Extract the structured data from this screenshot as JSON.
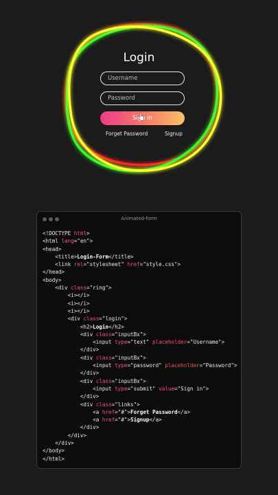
{
  "preview": {
    "title": "Login",
    "username_placeholder": "Username",
    "password_placeholder": "Password",
    "signin_label": "Sign in",
    "forget_label": "Forget Password",
    "signup_label": "Signup",
    "colors": {
      "ring_red": "#ff2424",
      "ring_green": "#2cff2c",
      "ring_yellow": "#ffff2c",
      "button_start": "#f03c8c",
      "button_end": "#fbc168"
    }
  },
  "editor": {
    "title": "Animated-form",
    "lines": [
      [
        {
          "t": "<!DOCTYPE "
        },
        {
          "t": "html",
          "c": "attr"
        },
        {
          "t": ">"
        }
      ],
      [
        {
          "t": "<html "
        },
        {
          "t": "lang",
          "c": "attr"
        },
        {
          "t": "=\"en\">"
        }
      ],
      [
        {
          "t": "<head>"
        }
      ],
      [
        {
          "t": "    <title>"
        },
        {
          "t": "Login-Form",
          "c": "bold"
        },
        {
          "t": "</title>"
        }
      ],
      [
        {
          "t": "    <link "
        },
        {
          "t": "rel",
          "c": "attr"
        },
        {
          "t": "=\"stylesheet\" "
        },
        {
          "t": "href",
          "c": "attr"
        },
        {
          "t": "=\"style.css\">"
        }
      ],
      [
        {
          "t": "</head>"
        }
      ],
      [
        {
          "t": "<body>"
        }
      ],
      [
        {
          "t": "    <div "
        },
        {
          "t": "class",
          "c": "attr"
        },
        {
          "t": "=\"ring\">"
        }
      ],
      [
        {
          "t": "        <i></i>"
        }
      ],
      [
        {
          "t": "        <i></i>"
        }
      ],
      [
        {
          "t": "        <i></i>"
        }
      ],
      [
        {
          "t": "        <div "
        },
        {
          "t": "class",
          "c": "attr"
        },
        {
          "t": "=\"login\">"
        }
      ],
      [
        {
          "t": "            <h2>"
        },
        {
          "t": "Login",
          "c": "bold"
        },
        {
          "t": "</h2>"
        }
      ],
      [
        {
          "t": "            <div "
        },
        {
          "t": "class",
          "c": "attr"
        },
        {
          "t": "=\"inputBx\">"
        }
      ],
      [
        {
          "t": "                <input "
        },
        {
          "t": "type",
          "c": "attr"
        },
        {
          "t": "=\"text\" "
        },
        {
          "t": "placeholder",
          "c": "attr"
        },
        {
          "t": "=\"Username\">"
        }
      ],
      [
        {
          "t": "            </div>"
        }
      ],
      [
        {
          "t": "            <div "
        },
        {
          "t": "class",
          "c": "attr"
        },
        {
          "t": "=\"inputBx\">"
        }
      ],
      [
        {
          "t": "                <input "
        },
        {
          "t": "type",
          "c": "attr"
        },
        {
          "t": "=\"password\" "
        },
        {
          "t": "placeholder",
          "c": "attr"
        },
        {
          "t": "=\"Password\">"
        }
      ],
      [
        {
          "t": "            </div>"
        }
      ],
      [
        {
          "t": "            <div "
        },
        {
          "t": "class",
          "c": "attr"
        },
        {
          "t": "=\"inputBx\">"
        }
      ],
      [
        {
          "t": "                <input "
        },
        {
          "t": "type",
          "c": "attr"
        },
        {
          "t": "=\"submit\" "
        },
        {
          "t": "value",
          "c": "attr"
        },
        {
          "t": "=\"Sign in\">"
        }
      ],
      [
        {
          "t": "            </div>"
        }
      ],
      [
        {
          "t": "            <div "
        },
        {
          "t": "class",
          "c": "attr"
        },
        {
          "t": "=\"links\">"
        }
      ],
      [
        {
          "t": "                <a "
        },
        {
          "t": "href",
          "c": "attr"
        },
        {
          "t": "=\"#\">"
        },
        {
          "t": "Forget Password",
          "c": "bold"
        },
        {
          "t": "</a>"
        }
      ],
      [
        {
          "t": "                <a "
        },
        {
          "t": "href",
          "c": "attr"
        },
        {
          "t": "=\"#\">"
        },
        {
          "t": "Signup",
          "c": "bold"
        },
        {
          "t": "</a>"
        }
      ],
      [
        {
          "t": "            </div>"
        }
      ],
      [
        {
          "t": "        </div>"
        }
      ],
      [
        {
          "t": "    </div>"
        }
      ],
      [
        {
          "t": "</body>"
        }
      ],
      [
        {
          "t": "</html>"
        }
      ]
    ]
  }
}
